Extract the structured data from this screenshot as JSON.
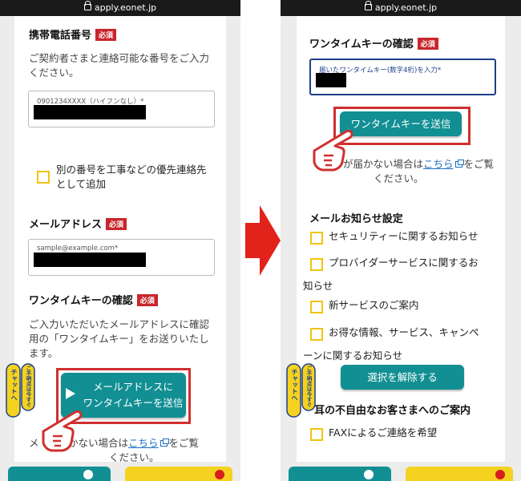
{
  "browser": {
    "url": "apply.eonet.jp"
  },
  "colors": {
    "accent": "#128f93",
    "required": "#c8262c",
    "highlight": "#d0302f",
    "link": "#1b6ec2",
    "checkbox": "#f1c40f"
  },
  "left": {
    "phone_section": {
      "title": "携帯電話番号",
      "badge": "必須",
      "desc_line1": "ご契約者さまと連絡可能な番号をご入力",
      "desc_line2": "ください。",
      "placeholder": "0901234XXXX（ハイフンなし）*"
    },
    "priority_option": {
      "line1": "別の番号を工事などの優先連絡先",
      "line2": "として追加"
    },
    "email_section": {
      "title": "メールアドレス",
      "badge": "必須",
      "placeholder": "sample@example.com*"
    },
    "otp_section": {
      "title": "ワンタイムキーの確認",
      "badge": "必須",
      "desc_line1": "ご入力いただいたメールアドレスに確認",
      "desc_line2": "用の「ワンタイムキー」をお送りいたし",
      "desc_line3": "ます。",
      "button_line1": "メールアドレスに",
      "button_line2": "ワンタイムキーを送信"
    },
    "notice": {
      "prefix": "メ",
      "middle": "届かない場合は",
      "link": "こちら",
      "suffix": "をご覧",
      "line2": "ください。"
    }
  },
  "right": {
    "otp_section": {
      "title": "ワンタイムキーの確認",
      "badge": "必須",
      "placeholder": "届いたワンタイムキー(数字4桁)を入力*",
      "send_button": "ワンタイムキーを送信"
    },
    "notice": {
      "middle": "が届かない場合は",
      "link": "こちら",
      "suffix": "をご覧",
      "line2": "ください。"
    },
    "mail_settings": {
      "title": "メールお知らせ設定",
      "options": [
        {
          "label": "セキュリティーに関するお知らせ"
        },
        {
          "label": "プロバイダーサービスに関するお",
          "cont": "知らせ"
        },
        {
          "label": "新サービスのご案内"
        },
        {
          "label": "お得な情報、サービス、キャンペ",
          "cont": "ーンに関するお知らせ"
        }
      ],
      "deselect_button": "選択を解除する"
    },
    "accessibility": {
      "title": "耳の不自由なお客さまへのご案内",
      "fax_option": "FAXによるご連絡を希望"
    }
  },
  "chat_tab": {
    "label_top": "ご不明点は今すぐ",
    "label_bottom": "チャットへ"
  }
}
